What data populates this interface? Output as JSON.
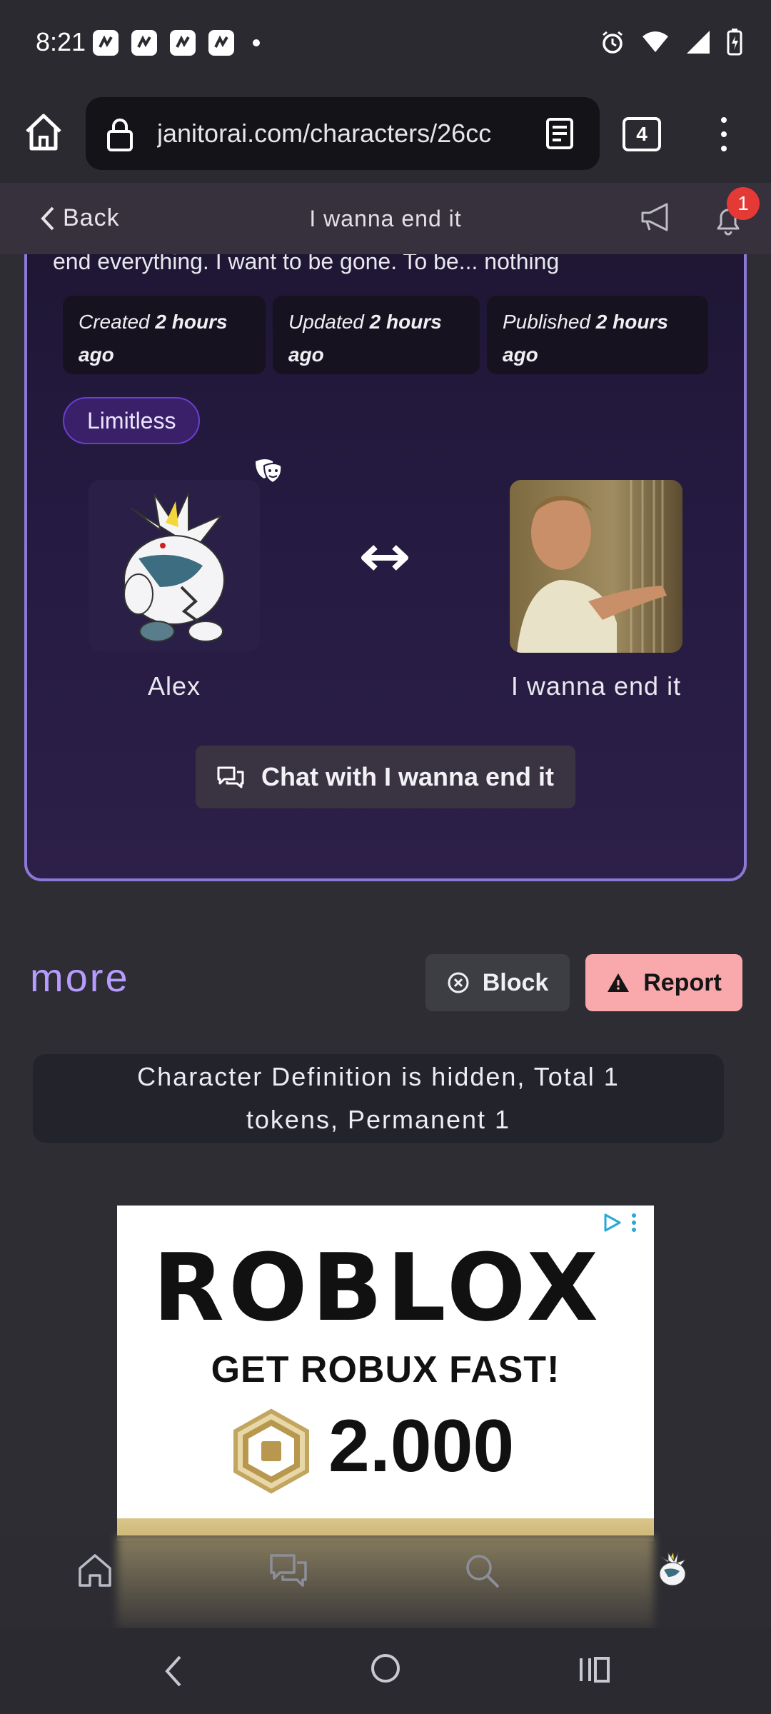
{
  "status_bar": {
    "time": "8:21"
  },
  "browser": {
    "url": "janitorai.com/characters/26cc",
    "tab_count": "4"
  },
  "header": {
    "back_label": "Back",
    "title": "I wanna end it",
    "notification_count": "1"
  },
  "character": {
    "description_tail": "end everything. I want to be gone. To be... nothing",
    "meta": [
      {
        "label": "Created",
        "value": "2 hours",
        "suffix": "ago"
      },
      {
        "label": "Updated",
        "value": "2 hours",
        "suffix": "ago"
      },
      {
        "label": "Published",
        "value": "2 hours",
        "suffix": "ago"
      }
    ],
    "tag": "Limitless",
    "user_name": "Alex",
    "bot_name": "I wanna end it",
    "chat_button": "Chat with I wanna end it"
  },
  "more_section": {
    "title": "more",
    "block_label": "Block",
    "report_label": "Report",
    "definition_line1": "Character Definition is hidden, Total 1",
    "definition_line2": "tokens, Permanent 1"
  },
  "ad": {
    "brand": "ROBLOX",
    "tagline": "GET ROBUX FAST!",
    "amount": "2.000"
  },
  "colors": {
    "accent": "#b79cff",
    "card_border": "#8c78d6",
    "report": "#f9a8ac",
    "badge": "#e53935"
  },
  "bottom_nav": {
    "icons": [
      "home-icon",
      "chat-icon",
      "search-icon",
      "profile-avatar"
    ]
  }
}
